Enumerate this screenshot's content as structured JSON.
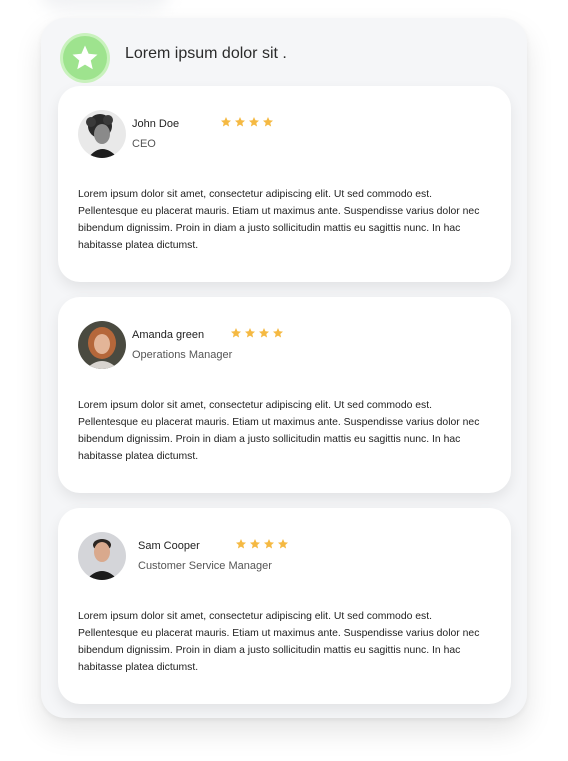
{
  "header": {
    "title": "Lorem ipsum dolor sit .",
    "badge_icon": "star-icon",
    "badge_color": "#9ee38e"
  },
  "star_color": "#f5b942",
  "testimonials": [
    {
      "name": "John Doe",
      "role": "CEO",
      "rating": 4,
      "review": "Lorem ipsum dolor sit amet, consectetur adipiscing elit. Ut sed commodo est. Pellentesque eu placerat mauris. Etiam ut maximus ante. Suspendisse varius dolor nec bibendum dignissim. Proin in diam a justo sollicitudin mattis eu sagittis nunc. In hac habitasse platea dictumst."
    },
    {
      "name": "Amanda green",
      "role": "Operations Manager",
      "rating": 4,
      "review": "Lorem ipsum dolor sit amet, consectetur adipiscing elit. Ut sed commodo est. Pellentesque eu placerat mauris. Etiam ut maximus ante. Suspendisse varius dolor nec bibendum dignissim. Proin in diam a justo sollicitudin mattis eu sagittis nunc. In hac habitasse platea dictumst."
    },
    {
      "name": "Sam Cooper",
      "role": "Customer Service Manager",
      "rating": 4,
      "review": "Lorem ipsum dolor sit amet, consectetur adipiscing elit. Ut sed commodo est. Pellentesque eu placerat mauris. Etiam ut maximus ante. Suspendisse varius dolor nec bibendum dignissim. Proin in diam a justo sollicitudin mattis eu sagittis nunc. In hac habitasse platea dictumst."
    }
  ]
}
